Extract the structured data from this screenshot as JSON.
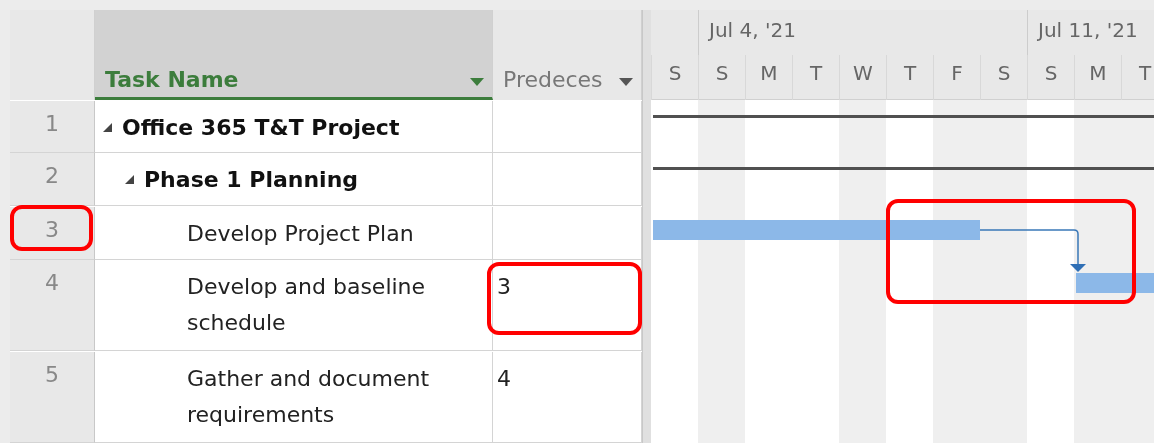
{
  "columns": [
    {
      "label": "Task Name",
      "selected": true
    },
    {
      "label": "Predeces",
      "selected": false
    }
  ],
  "timescale": {
    "weeks": [
      {
        "label": "Jul 4, '21"
      },
      {
        "label": "Jul 11, '21"
      }
    ],
    "days": [
      {
        "label": "S",
        "shaded": false
      },
      {
        "label": "S",
        "shaded": true
      },
      {
        "label": "M",
        "shaded": false
      },
      {
        "label": "T",
        "shaded": false
      },
      {
        "label": "W",
        "shaded": true
      },
      {
        "label": "T",
        "shaded": false
      },
      {
        "label": "F",
        "shaded": true
      },
      {
        "label": "S",
        "shaded": true
      },
      {
        "label": "S",
        "shaded": false
      },
      {
        "label": "M",
        "shaded": true
      },
      {
        "label": "T",
        "shaded": true
      }
    ]
  },
  "tasks": [
    {
      "id": "1",
      "name": "Office 365 T&T Project",
      "kind": "summary",
      "expanded": true,
      "id_marked": false,
      "pred_marked": false,
      "children": [
        {
          "id": "2",
          "name": "Phase 1 Planning",
          "kind": "summary",
          "expanded": true,
          "id_marked": false,
          "pred_marked": false,
          "children": [
            {
              "id": "3",
              "name": "Develop Project Plan",
              "kind": "task",
              "id_marked": true,
              "pred_marked": false
            },
            {
              "id": "4",
              "name": "Develop and baseline schedule",
              "predecessors": "3",
              "kind": "task",
              "id_marked": false,
              "pred_marked": true,
              "link_marked": true
            },
            {
              "id": "5",
              "name": "Gather and document requirements",
              "predecessors": "4",
              "kind": "task",
              "id_marked": false,
              "pred_marked": false
            }
          ]
        }
      ]
    }
  ]
}
